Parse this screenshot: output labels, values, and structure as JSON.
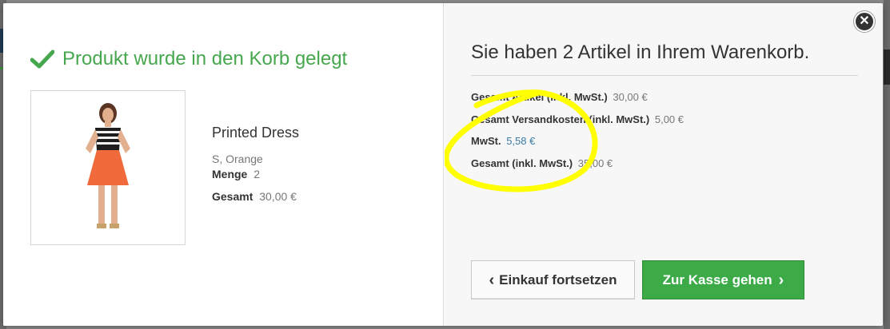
{
  "modal": {
    "close_glyph": "✕",
    "added_title": "Produkt wurde in den Korb gelegt",
    "product": {
      "name": "Printed Dress",
      "attributes": "S, Orange",
      "quantity_label": "Menge",
      "quantity": "2",
      "total_label": "Gesamt",
      "total": "30,00 €"
    },
    "cart": {
      "title": "Sie haben 2 Artikel in Ihrem Warenkorb.",
      "summary": [
        {
          "label": "Gesamt Artikel (inkl. MwSt.)",
          "value": "30,00 €"
        },
        {
          "label": "Gesamt Versandkosten (inkl. MwSt.)",
          "value": "5,00 €"
        },
        {
          "label": "MwSt.",
          "value": "5,58 €"
        },
        {
          "label": "Gesamt (inkl. MwSt.)",
          "value": "35,00 €"
        }
      ],
      "continue_button": "Einkauf fortsetzen",
      "checkout_button": "Zur Kasse gehen"
    },
    "colors": {
      "success_green": "#46a74e",
      "button_green": "#3daa48",
      "tax_link_blue": "#3b7aa6",
      "highlight_yellow": "#ffff00"
    },
    "icons": {
      "check": "check-icon",
      "close": "close-icon",
      "continue_chevron": "chevron-left-icon",
      "checkout_chevron": "chevron-right-icon"
    }
  }
}
